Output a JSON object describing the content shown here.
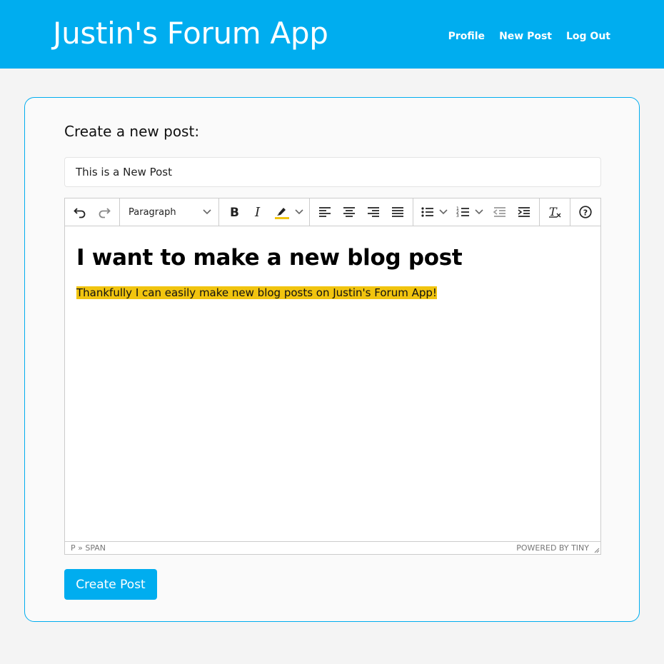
{
  "navbar": {
    "brand": "Justin's Forum App",
    "links": [
      "Profile",
      "New Post",
      "Log Out"
    ],
    "color": "#00adef"
  },
  "form": {
    "heading": "Create a new post:",
    "title_value": "This is a New Post",
    "submit_label": "Create Post"
  },
  "editor": {
    "block_format": "Paragraph",
    "toolbar_icons": [
      "undo-icon",
      "redo-icon",
      "bold-icon",
      "italic-icon",
      "highlight-icon",
      "align-left-icon",
      "align-center-icon",
      "align-right-icon",
      "justify-icon",
      "bullet-list-icon",
      "numbered-list-icon",
      "outdent-icon",
      "indent-icon",
      "clear-formatting-icon",
      "help-icon"
    ],
    "heading": "I want to make a new blog post",
    "paragraph": "Thankfully I can easily make new blog posts on Justin's Forum App!",
    "highlight_color": "#f1c40f",
    "status_path": "P » SPAN",
    "powered_by": "POWERED BY TINY"
  }
}
